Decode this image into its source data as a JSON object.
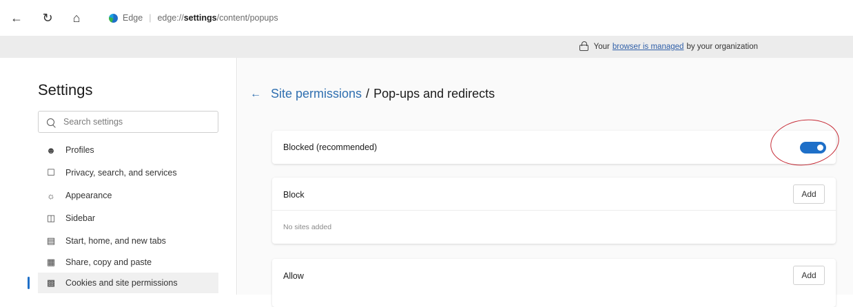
{
  "browser": {
    "brand": "Edge",
    "url_prefix": "edge://",
    "url_bold": "settings",
    "url_suffix": "/content/popups"
  },
  "managed_bar": {
    "prefix": "Your",
    "link": "browser is managed",
    "suffix": "by your organization"
  },
  "sidebar": {
    "title": "Settings",
    "search_placeholder": "Search settings",
    "items": [
      {
        "icon": "profile-icon",
        "label": "Profiles"
      },
      {
        "icon": "lock-icon",
        "label": "Privacy, search, and services"
      },
      {
        "icon": "appearance-icon",
        "label": "Appearance"
      },
      {
        "icon": "sidebar-icon",
        "label": "Sidebar"
      },
      {
        "icon": "start-home-icon",
        "label": "Start, home, and new tabs"
      },
      {
        "icon": "share-icon",
        "label": "Share, copy and paste"
      },
      {
        "icon": "cookies-icon",
        "label": "Cookies and site permissions",
        "active": true
      }
    ]
  },
  "main": {
    "breadcrumb_link": "Site permissions",
    "breadcrumb_sep": "/",
    "breadcrumb_current": "Pop-ups and redirects",
    "blocked_label": "Blocked (recommended)",
    "blocked_toggle_on": true,
    "block_section": {
      "title": "Block",
      "add_label": "Add",
      "empty_text": "No sites added"
    },
    "allow_section": {
      "title": "Allow",
      "add_label": "Add"
    }
  },
  "colors": {
    "accent": "#1e6fc8",
    "link": "#2f6fb0",
    "annotation": "#c62a35"
  }
}
